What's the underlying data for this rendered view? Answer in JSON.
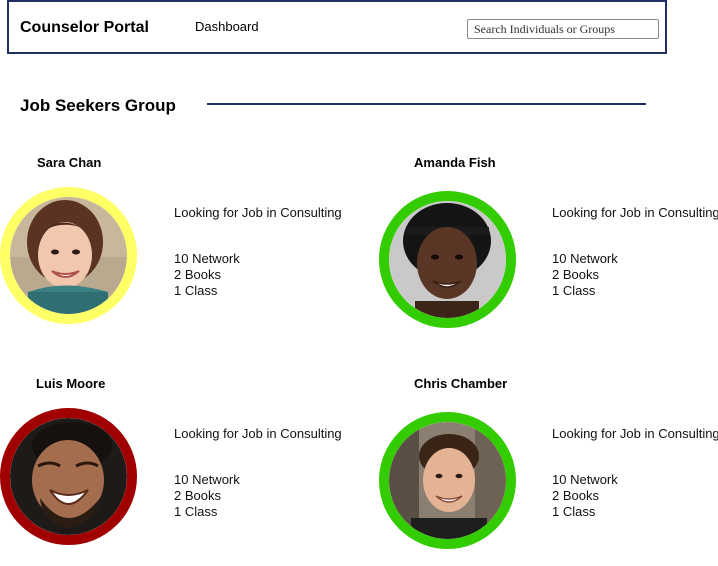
{
  "header": {
    "app_title": "Counselor Portal",
    "nav": {
      "dashboard_label": "Dashboard"
    },
    "search": {
      "placeholder": "Search Individuals or Groups"
    }
  },
  "section": {
    "title": "Job Seekers Group"
  },
  "members": [
    {
      "name": "Sara Chan",
      "status": "Looking for Job in Consulting",
      "network": "10 Network",
      "books": "2 Books",
      "classes": "1 Class",
      "ring_color": "#ffff66"
    },
    {
      "name": "Amanda Fish",
      "status": "Looking for Job in Consulting",
      "network": "10 Network",
      "books": "2 Books",
      "classes": "1 Class",
      "ring_color": "#33cc00"
    },
    {
      "name": "Luis Moore",
      "status": "Looking for Job in Consulting",
      "network": "10 Network",
      "books": "2 Books",
      "classes": "1 Class",
      "ring_color": "#a00000"
    },
    {
      "name": "Chris Chamber",
      "status": "Looking for Job in Consulting",
      "network": "10 Network",
      "books": "2 Books",
      "classes": "1 Class",
      "ring_color": "#33cc00"
    }
  ]
}
